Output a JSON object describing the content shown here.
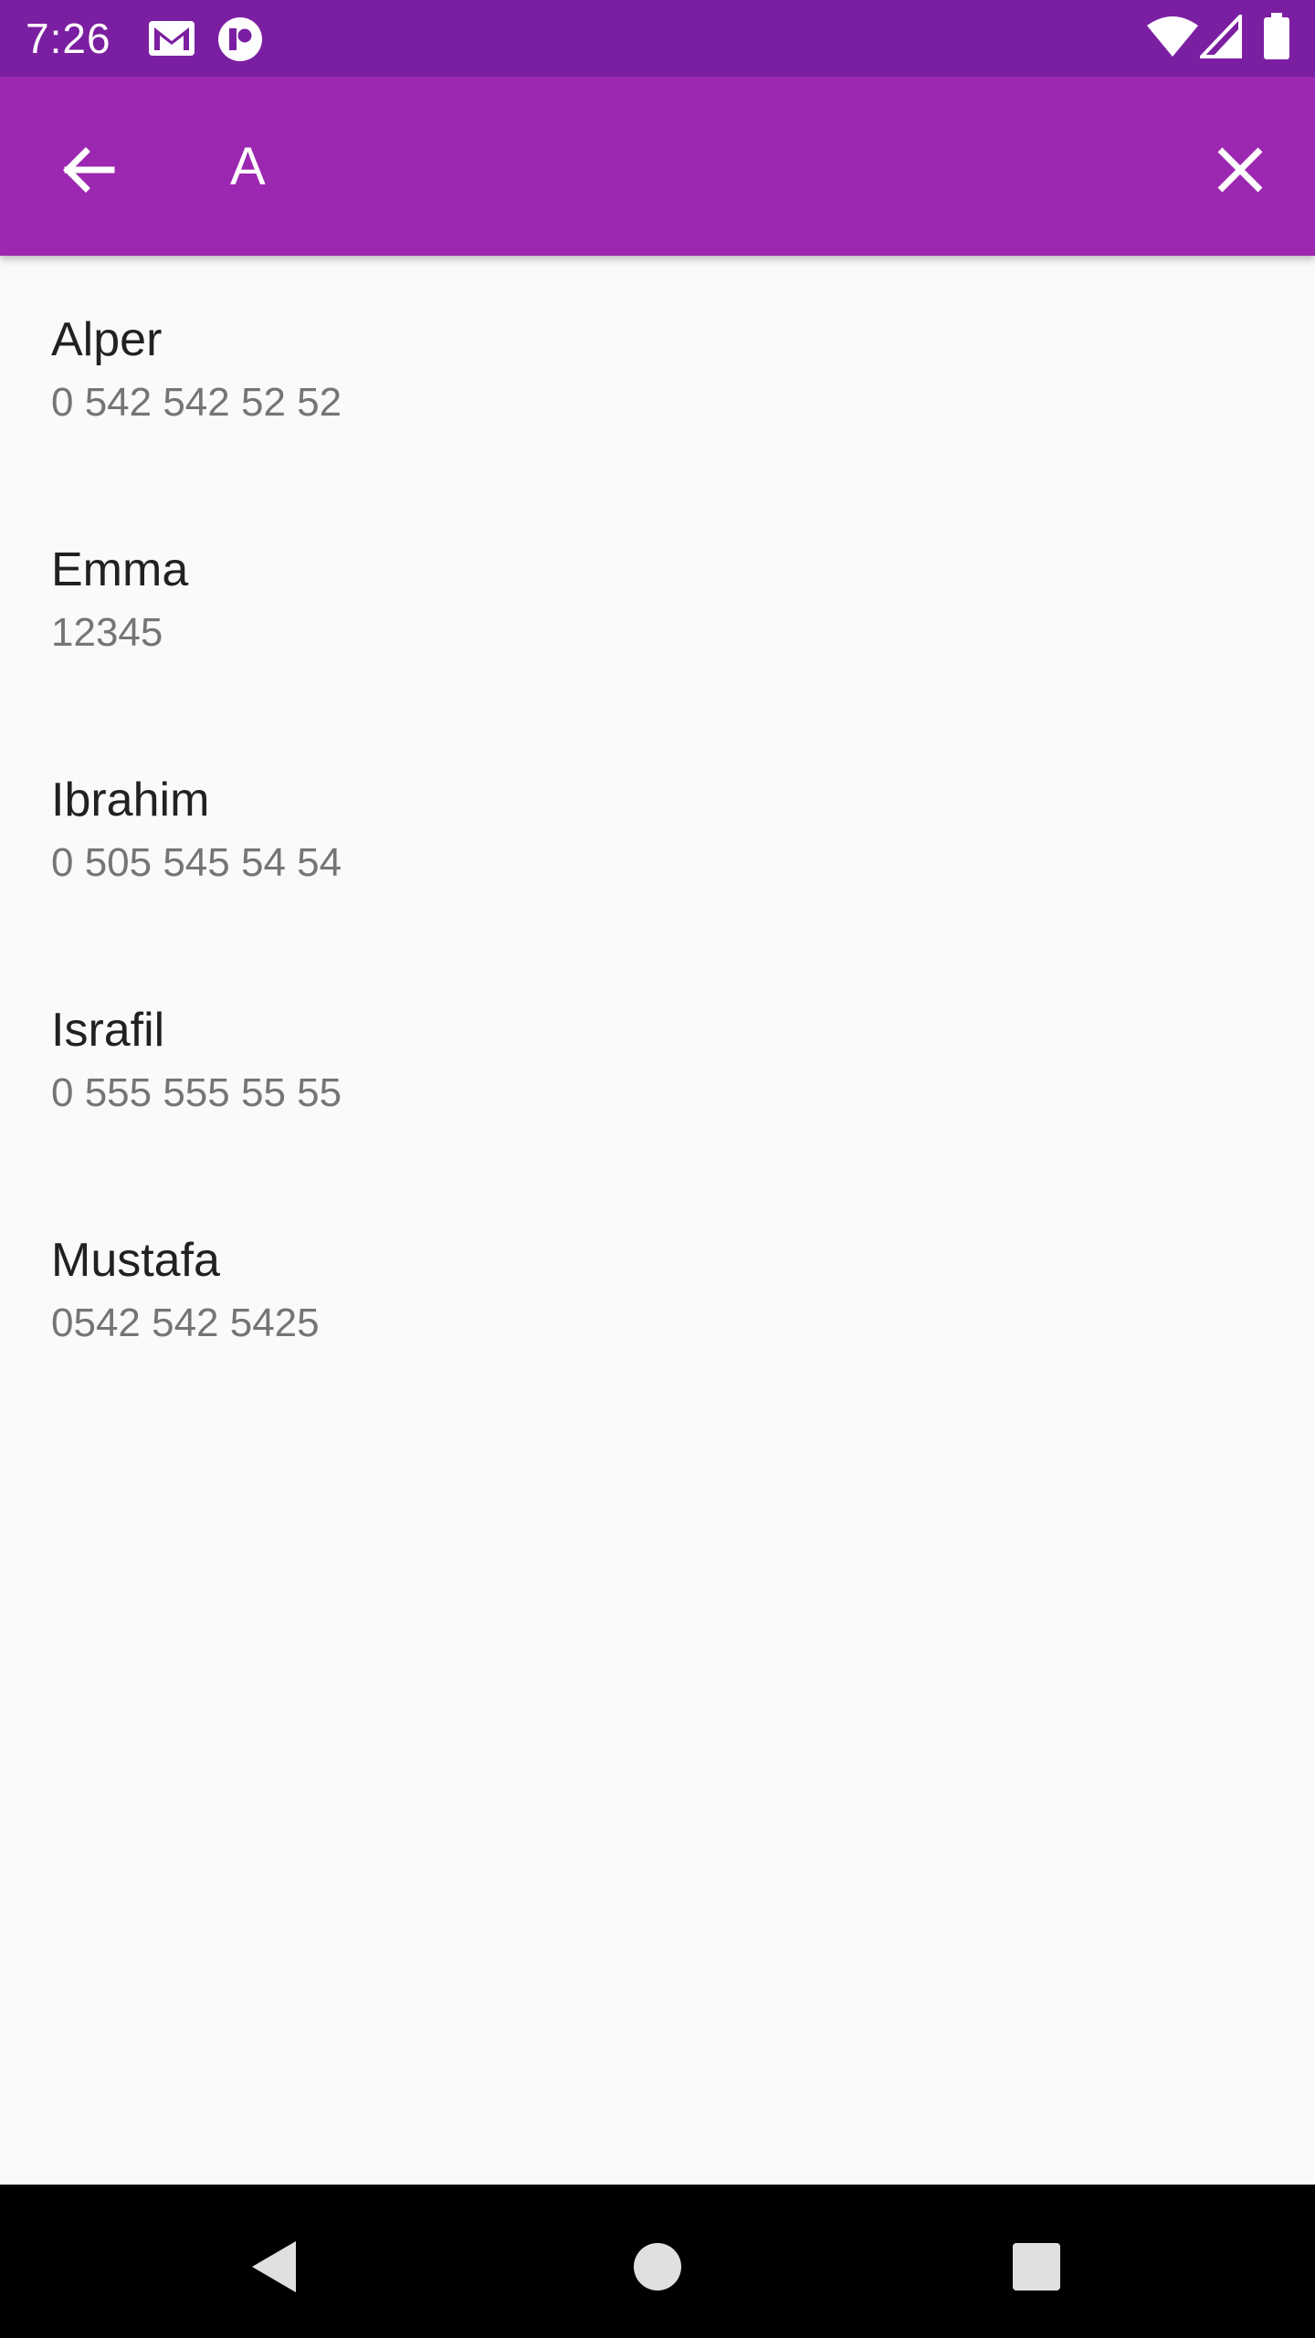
{
  "status_bar": {
    "time": "7:26",
    "icons": [
      "gmail-icon",
      "notification-app-icon",
      "wifi-icon",
      "signal-icon",
      "battery-icon"
    ]
  },
  "app_bar": {
    "search_value": "A",
    "back_icon": "arrow-back-icon",
    "clear_icon": "close-icon",
    "color": "#9c27b0",
    "status_color": "#7b1fa2"
  },
  "contacts": [
    {
      "name": "Alper",
      "phone": "0 542 542 52 52"
    },
    {
      "name": "Emma",
      "phone": "12345"
    },
    {
      "name": "Ibrahim",
      "phone": "0 505 545 54 54"
    },
    {
      "name": "Israfil",
      "phone": "0 555 555 55 55"
    },
    {
      "name": "Mustafa",
      "phone": "0542 542 5425"
    }
  ],
  "nav_bar": {
    "icons": [
      "back-triangle-icon",
      "home-circle-icon",
      "recents-square-icon"
    ]
  }
}
